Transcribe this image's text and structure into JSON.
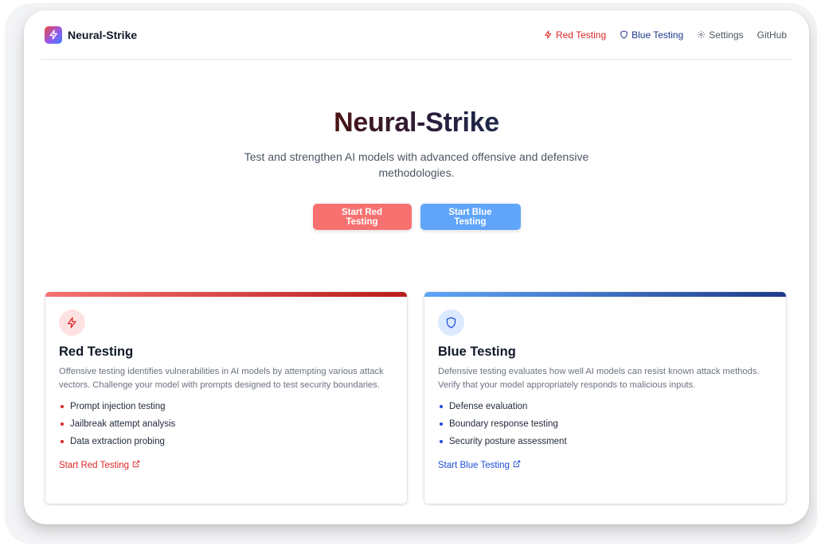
{
  "app": {
    "brand_name": "Neural-Strike",
    "logo_icon": "zap-icon"
  },
  "nav": {
    "red_testing": "Red Testing",
    "blue_testing": "Blue Testing",
    "settings": "Settings",
    "github": "GitHub"
  },
  "hero": {
    "title": "Neural-Strike",
    "subtitle": "Test and strengthen AI models with advanced offensive and defensive methodologies.",
    "red_button": "Start Red Testing",
    "blue_button": "Start Blue Testing"
  },
  "cards": {
    "red": {
      "icon": "zap-icon",
      "title": "Red Testing",
      "description": "Offensive testing identifies vulnerabilities in AI models by attempting various attack vectors. Challenge your model with prompts designed to test security boundaries.",
      "items": [
        "Prompt injection testing",
        "Jailbreak attempt analysis",
        "Data extraction probing"
      ],
      "link": "Start Red Testing"
    },
    "blue": {
      "icon": "shield-icon",
      "title": "Blue Testing",
      "description": "Defensive testing evaluates how well AI models can resist known attack methods. Verify that your model appropriately responds to malicious inputs.",
      "items": [
        "Defense evaluation",
        "Boundary response testing",
        "Security posture assessment"
      ],
      "link": "Start Blue Testing"
    }
  },
  "colors": {
    "red_accent": "#dc2626",
    "blue_accent": "#1e3a8a",
    "red_button": "#f87171",
    "blue_button": "#60a5fa"
  }
}
